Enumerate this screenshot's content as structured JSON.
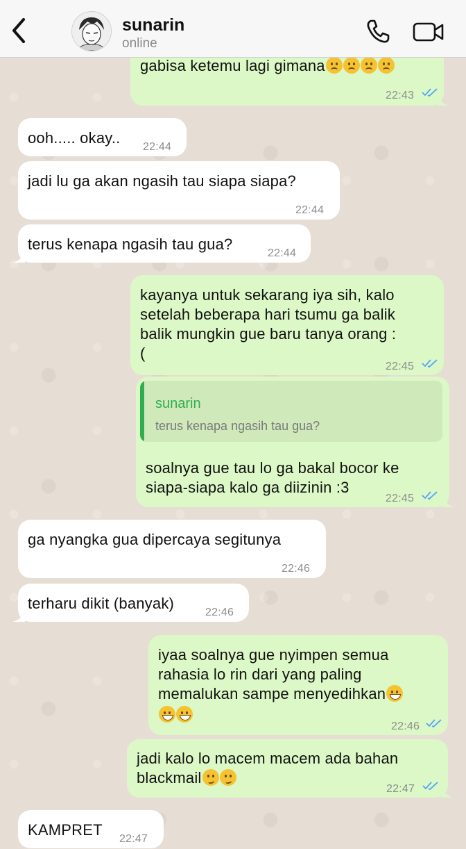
{
  "header": {
    "contact_name": "sunarin",
    "status": "online",
    "back_icon": "chevron-left-icon",
    "call_icon": "phone-icon",
    "video_icon": "video-camera-icon"
  },
  "colors": {
    "incoming_bubble": "#ffffff",
    "outgoing_bubble": "#dcf8c6",
    "read_ticks": "#4fa3f7",
    "quote_accent": "#2fae4f"
  },
  "messages": [
    {
      "direction": "out",
      "text": "gabisa ketemu lagi gimana",
      "emoji": [
        "confused",
        "confused",
        "confused",
        "confused"
      ],
      "time": "22:43",
      "status": "read"
    },
    {
      "direction": "in",
      "text": "ooh..... okay..",
      "time": "22:44"
    },
    {
      "direction": "in",
      "text": "jadi lu ga akan ngasih tau siapa siapa?",
      "time": "22:44"
    },
    {
      "direction": "in",
      "text": "terus kenapa ngasih tau gua?",
      "time": "22:44"
    },
    {
      "direction": "out",
      "lines": [
        "kayanya untuk sekarang iya sih, kalo",
        "setelah beberapa hari tsumu ga balik",
        "balik mungkin gue baru tanya orang :",
        "("
      ],
      "time": "22:45",
      "status": "read"
    },
    {
      "direction": "out",
      "reply_to": {
        "name": "sunarin",
        "text": "terus kenapa ngasih tau gua?"
      },
      "lines": [
        "soalnya gue tau lo ga bakal bocor ke",
        "siapa-siapa kalo ga diizinin :3"
      ],
      "time": "22:45",
      "status": "read"
    },
    {
      "direction": "in",
      "text": "ga nyangka gua dipercaya segitunya",
      "time": "22:46"
    },
    {
      "direction": "in",
      "text": "terharu dikit (banyak)",
      "time": "22:46"
    },
    {
      "direction": "out",
      "lines": [
        "iyaa soalnya gue nyimpen semua",
        "rahasia lo rin dari yang paling",
        "memalukan sampe menyedihkan"
      ],
      "emoji": [
        "grin",
        "grin",
        "grin"
      ],
      "time": "22:46",
      "status": "read"
    },
    {
      "direction": "out",
      "lines": [
        "jadi kalo lo macem macem ada bahan",
        "blackmail"
      ],
      "emoji": [
        "smirk",
        "smirk"
      ],
      "time": "22:47",
      "status": "read"
    },
    {
      "direction": "in",
      "text": "KAMPRET",
      "time": "22:47"
    }
  ]
}
